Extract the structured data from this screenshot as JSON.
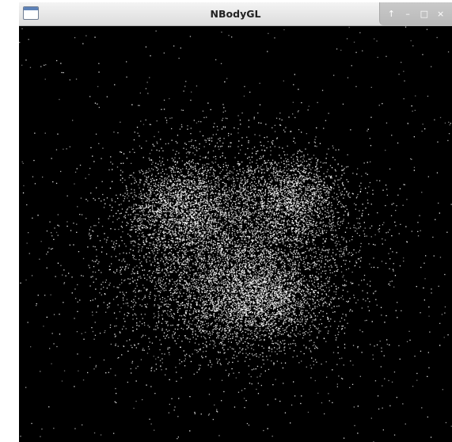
{
  "window": {
    "title": "NBodyGL"
  },
  "controls": {
    "shade": {
      "icon": "shade-up-icon",
      "glyph": "↑"
    },
    "minimize": {
      "icon": "minimize-icon",
      "glyph": "–"
    },
    "maximize": {
      "icon": "maximize-icon",
      "glyph": "□"
    },
    "close": {
      "icon": "close-icon",
      "glyph": "×"
    }
  },
  "colors": {
    "background": "#000000",
    "particle": "#ffffff",
    "titlebar": "#e6e6e6"
  }
}
